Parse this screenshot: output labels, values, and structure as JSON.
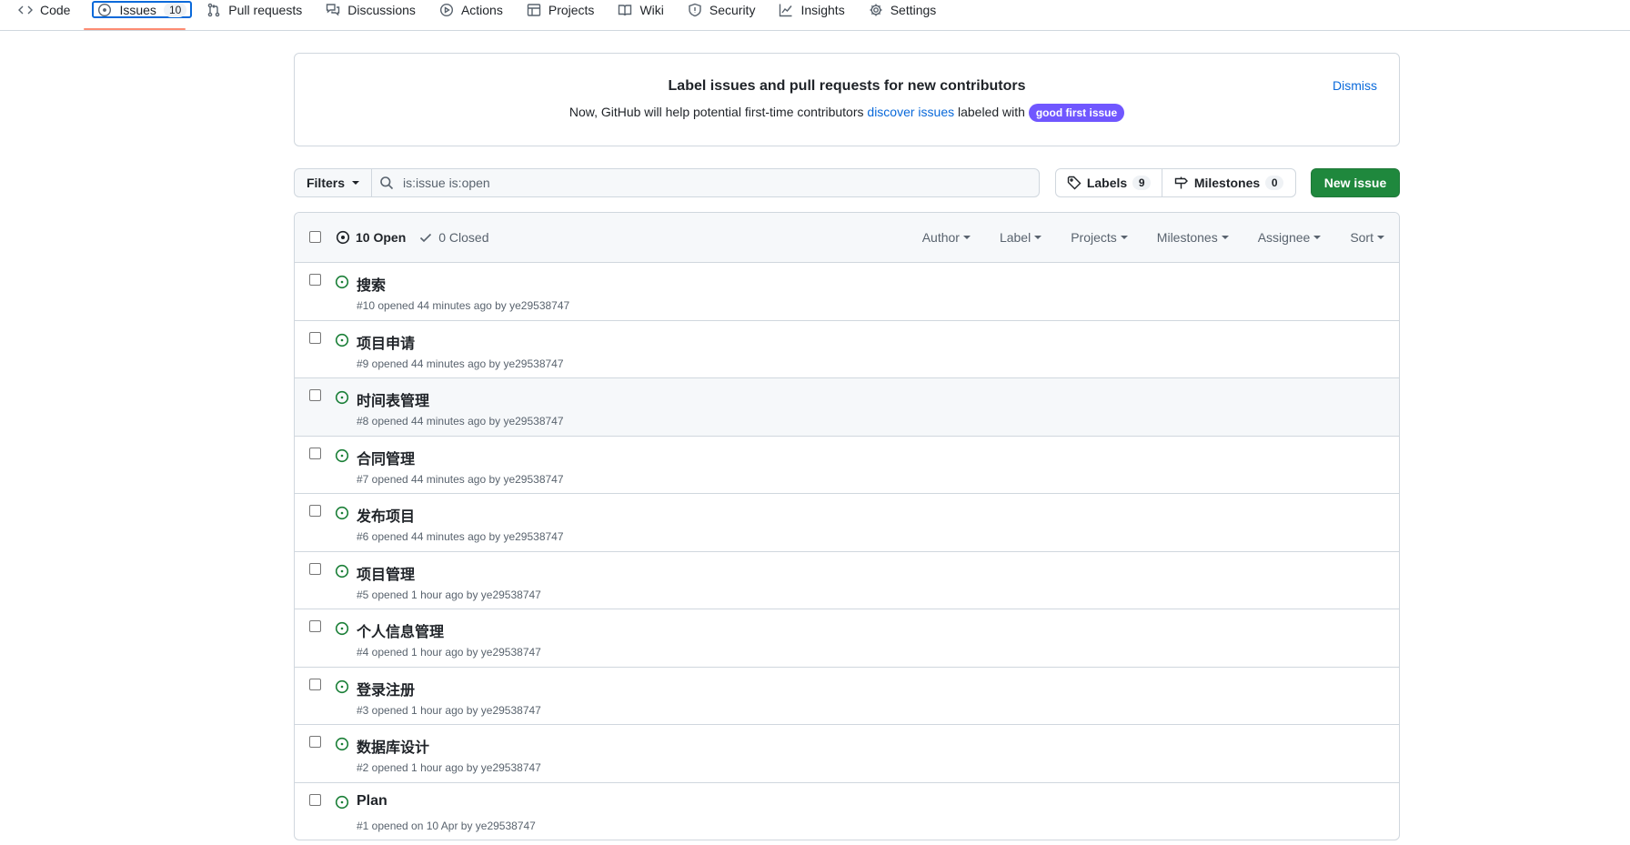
{
  "nav": {
    "items": [
      {
        "label": "Code",
        "icon": "code-icon"
      },
      {
        "label": "Issues",
        "icon": "issue-opened-icon",
        "count": "10",
        "selected": true
      },
      {
        "label": "Pull requests",
        "icon": "git-pull-request-icon"
      },
      {
        "label": "Discussions",
        "icon": "comment-discussion-icon"
      },
      {
        "label": "Actions",
        "icon": "play-icon"
      },
      {
        "label": "Projects",
        "icon": "table-icon"
      },
      {
        "label": "Wiki",
        "icon": "book-icon"
      },
      {
        "label": "Security",
        "icon": "shield-icon"
      },
      {
        "label": "Insights",
        "icon": "graph-icon"
      },
      {
        "label": "Settings",
        "icon": "gear-icon"
      }
    ],
    "accent_color": "#fd8c73"
  },
  "banner": {
    "title": "Label issues and pull requests for new contributors",
    "text_before": "Now, GitHub will help potential first-time contributors ",
    "link_text": "discover issues",
    "text_after": " labeled with ",
    "label": "good first issue",
    "label_color": "#7057ff",
    "dismiss": "Dismiss"
  },
  "filters": {
    "filters_label": "Filters",
    "search_value": "is:issue is:open",
    "labels_label": "Labels",
    "labels_count": "9",
    "milestones_label": "Milestones",
    "milestones_count": "0",
    "new_issue_label": "New issue",
    "new_issue_color": "#1f883d"
  },
  "list_header": {
    "open_label": "10 Open",
    "closed_label": "0 Closed",
    "sorters": [
      "Author",
      "Label",
      "Projects",
      "Milestones",
      "Assignee",
      "Sort"
    ]
  },
  "issues": [
    {
      "title": "搜索",
      "meta": "#10 opened 44 minutes ago by ye29538747"
    },
    {
      "title": "项目申请",
      "meta": "#9 opened 44 minutes ago by ye29538747"
    },
    {
      "title": "时间表管理",
      "meta": "#8 opened 44 minutes ago by ye29538747"
    },
    {
      "title": "合同管理",
      "meta": "#7 opened 44 minutes ago by ye29538747"
    },
    {
      "title": "发布项目",
      "meta": "#6 opened 44 minutes ago by ye29538747"
    },
    {
      "title": "项目管理",
      "meta": "#5 opened 1 hour ago by ye29538747"
    },
    {
      "title": "个人信息管理",
      "meta": "#4 opened 1 hour ago by ye29538747"
    },
    {
      "title": "登录注册",
      "meta": "#3 opened 1 hour ago by ye29538747"
    },
    {
      "title": "数据库设计",
      "meta": "#2 opened 1 hour ago by ye29538747"
    },
    {
      "title": "Plan",
      "meta": "#1 opened on 10 Apr by ye29538747"
    }
  ],
  "open_icon_color": "#1a7f37"
}
